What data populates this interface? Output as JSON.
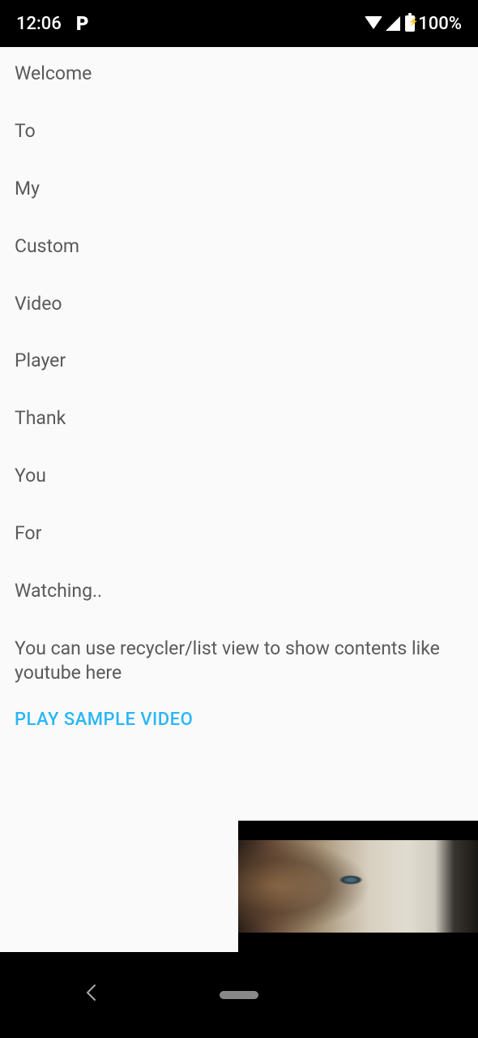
{
  "statusBar": {
    "time": "12:06",
    "battery": "100%"
  },
  "content": {
    "lines": [
      "Welcome",
      "To",
      "My",
      "Custom",
      "Video",
      "Player",
      "Thank",
      "You",
      "For",
      "Watching..",
      "You can use recycler/list view to show contents like youtube here"
    ],
    "playButton": "PLAY SAMPLE VIDEO"
  }
}
